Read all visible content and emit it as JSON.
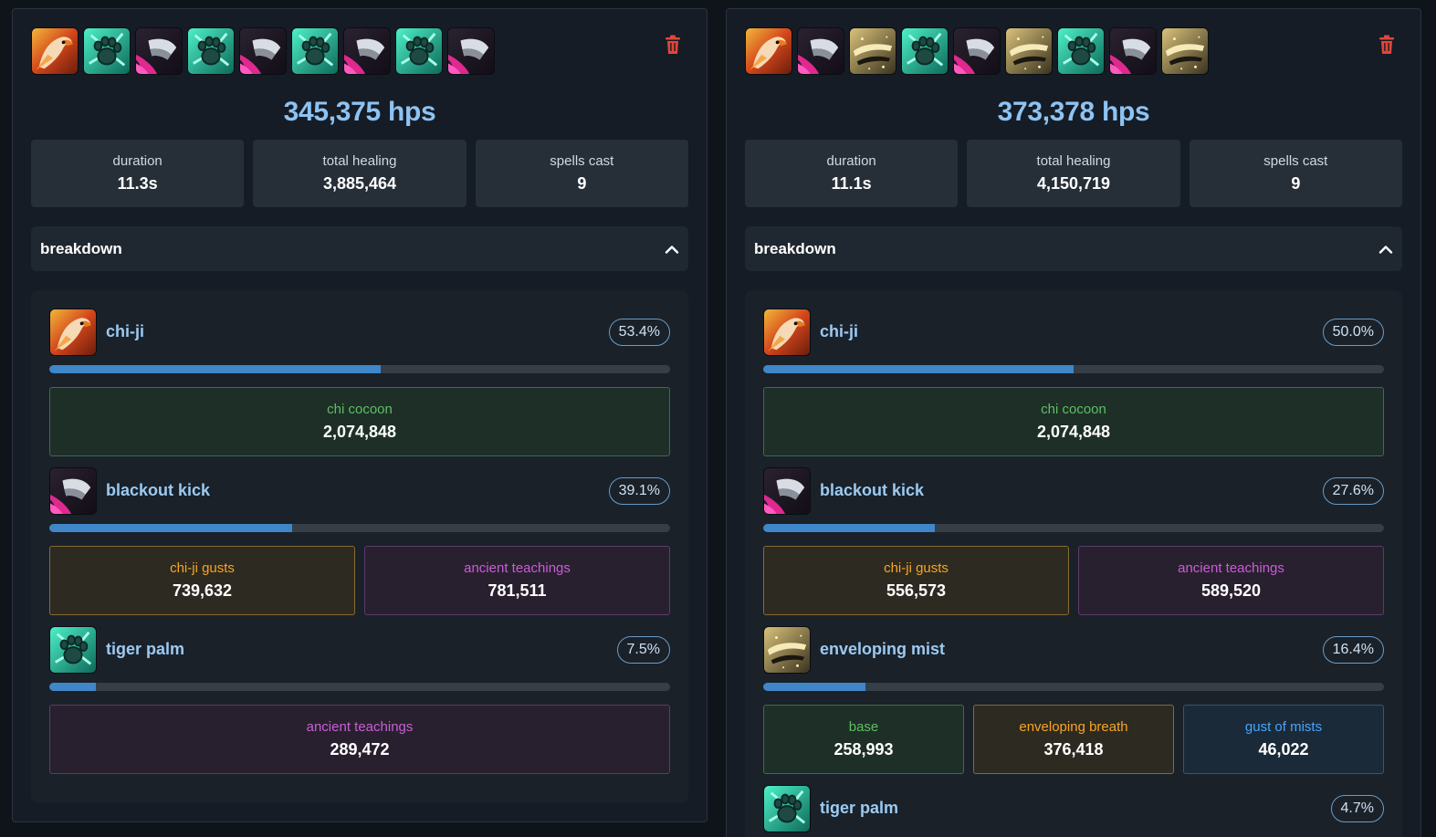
{
  "colors": {
    "accent_blue": "#8ec3f2",
    "bar_fill": "#3f87c9",
    "green_label": "#5dbf61",
    "orange_label": "#f5a623",
    "purple_label": "#c85ed6",
    "blue_label": "#45a5ff",
    "delete_red": "#e0463a"
  },
  "panels": [
    {
      "sequence": [
        "chi-ji",
        "tiger-palm",
        "blackout-kick",
        "tiger-palm",
        "blackout-kick",
        "tiger-palm",
        "blackout-kick",
        "tiger-palm",
        "blackout-kick"
      ],
      "hps": "345,375 hps",
      "stats": [
        {
          "label": "duration",
          "value": "11.3s"
        },
        {
          "label": "total healing",
          "value": "3,885,464"
        },
        {
          "label": "spells cast",
          "value": "9"
        }
      ],
      "breakdown_title": "breakdown",
      "spells": [
        {
          "icon": "chi-ji",
          "name": "chi-ji",
          "pct": "53.4%",
          "share": 0.534,
          "subs": [
            {
              "label": "chi cocoon",
              "value": "2,074,848",
              "color": "green"
            }
          ]
        },
        {
          "icon": "blackout-kick",
          "name": "blackout kick",
          "pct": "39.1%",
          "share": 0.391,
          "subs": [
            {
              "label": "chi-ji gusts",
              "value": "739,632",
              "color": "orange"
            },
            {
              "label": "ancient teachings",
              "value": "781,511",
              "color": "purple"
            }
          ]
        },
        {
          "icon": "tiger-palm",
          "name": "tiger palm",
          "pct": "7.5%",
          "share": 0.075,
          "subs": [
            {
              "label": "ancient teachings",
              "value": "289,472",
              "color": "purple"
            }
          ]
        }
      ]
    },
    {
      "sequence": [
        "chi-ji",
        "blackout-kick",
        "enveloping-mist",
        "tiger-palm",
        "blackout-kick",
        "enveloping-mist",
        "tiger-palm",
        "blackout-kick",
        "enveloping-mist"
      ],
      "hps": "373,378 hps",
      "stats": [
        {
          "label": "duration",
          "value": "11.1s"
        },
        {
          "label": "total healing",
          "value": "4,150,719"
        },
        {
          "label": "spells cast",
          "value": "9"
        }
      ],
      "breakdown_title": "breakdown",
      "spells": [
        {
          "icon": "chi-ji",
          "name": "chi-ji",
          "pct": "50.0%",
          "share": 0.5,
          "subs": [
            {
              "label": "chi cocoon",
              "value": "2,074,848",
              "color": "green"
            }
          ]
        },
        {
          "icon": "blackout-kick",
          "name": "blackout kick",
          "pct": "27.6%",
          "share": 0.276,
          "subs": [
            {
              "label": "chi-ji gusts",
              "value": "556,573",
              "color": "orange"
            },
            {
              "label": "ancient teachings",
              "value": "589,520",
              "color": "purple"
            }
          ]
        },
        {
          "icon": "enveloping-mist",
          "name": "enveloping mist",
          "pct": "16.4%",
          "share": 0.164,
          "subs": [
            {
              "label": "base",
              "value": "258,993",
              "color": "green"
            },
            {
              "label": "enveloping breath",
              "value": "376,418",
              "color": "orange"
            },
            {
              "label": "gust of mists",
              "value": "46,022",
              "color": "blue"
            }
          ]
        },
        {
          "icon": "tiger-palm",
          "name": "tiger palm",
          "pct": "4.7%",
          "share": 0.047,
          "subs": []
        }
      ]
    }
  ]
}
